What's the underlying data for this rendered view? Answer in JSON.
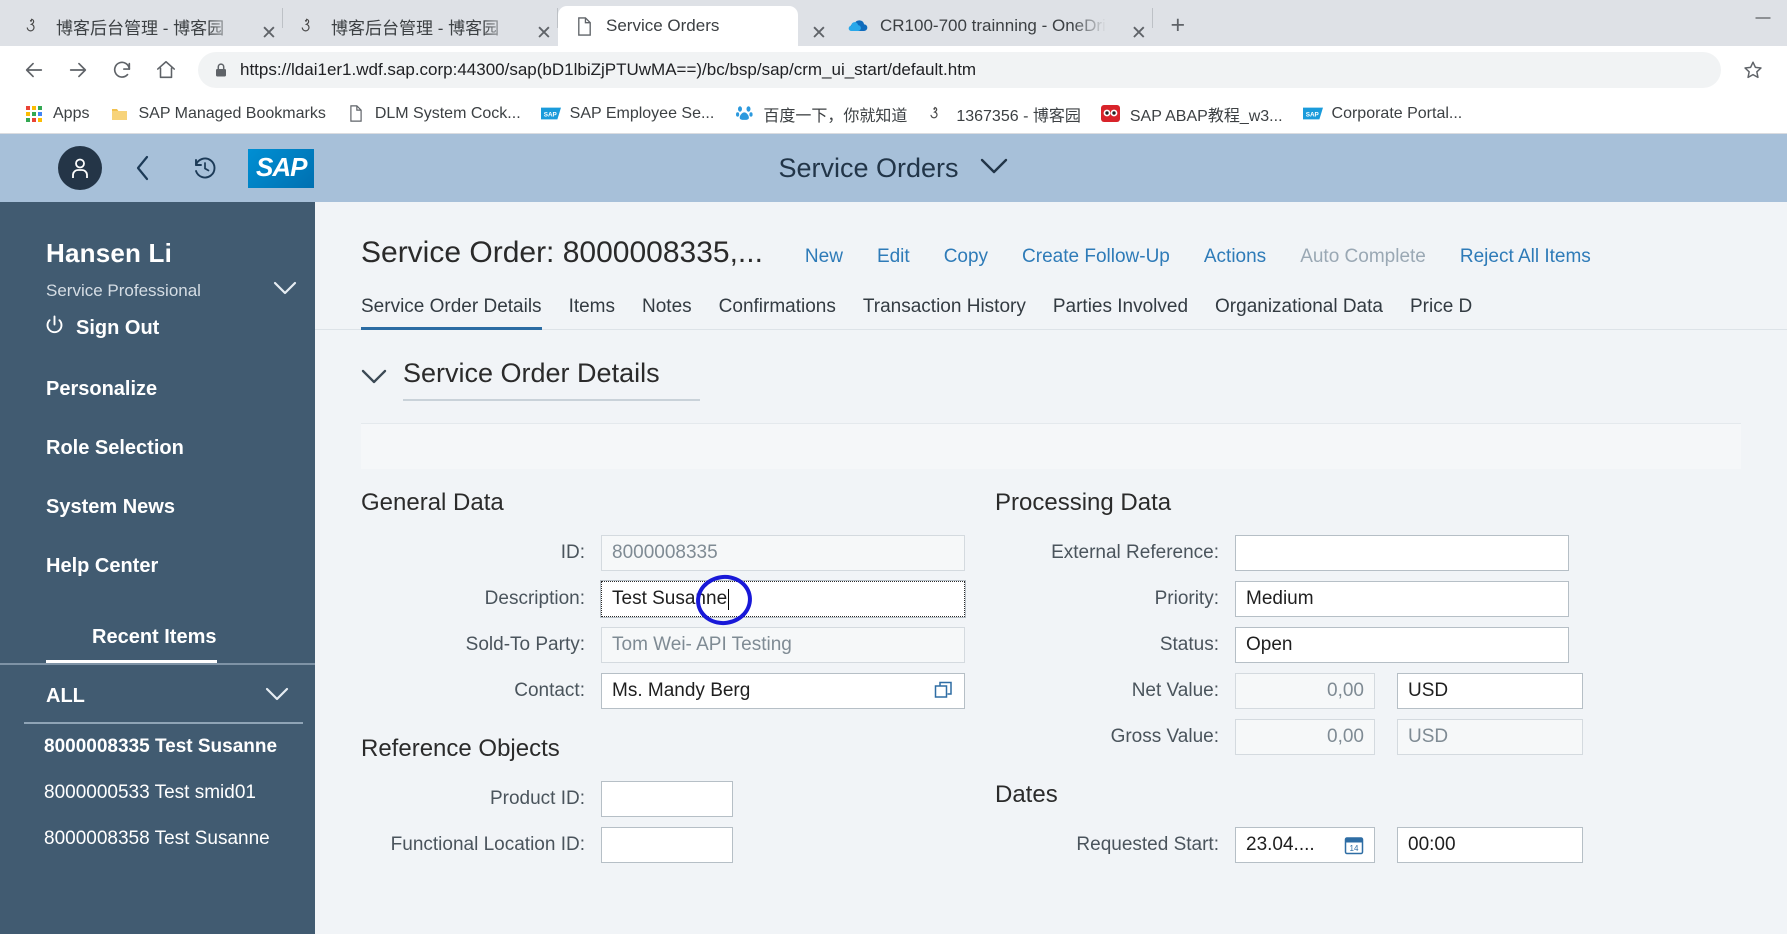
{
  "browser": {
    "tabs": [
      {
        "title": "博客后台管理 - 博客园",
        "favicon": "cnblogs-icon",
        "active": false
      },
      {
        "title": "博客后台管理 - 博客园",
        "favicon": "cnblogs-icon",
        "active": false
      },
      {
        "title": "Service Orders",
        "favicon": "page-icon",
        "active": true
      },
      {
        "title": "CR100-700 trainning - OneDri",
        "favicon": "onedrive-icon",
        "active": false
      }
    ],
    "new_tab_label": "+",
    "close_label": "✕",
    "window": {
      "minimize": "—"
    },
    "toolbar": {
      "back": "←",
      "forward": "→",
      "reload": "⟳",
      "home": "⌂",
      "star": "☆",
      "url_secure": "https://ldai1er1.wdf.sap.corp",
      "url_rest": ":44300/sap(bD1lbiZjPTUwMA==)/bc/bsp/sap/crm_ui_start/default.htm",
      "url_full": "https://ldai1er1.wdf.sap.corp:44300/sap(bD1lbiZjPTUwMA==)/bc/bsp/sap/crm_ui_start/default.htm"
    },
    "bookmarks": [
      {
        "label": "Apps",
        "icon": "apps-grid-icon"
      },
      {
        "label": "SAP Managed Bookmarks",
        "icon": "folder-icon"
      },
      {
        "label": "DLM System Cock...",
        "icon": "page-icon"
      },
      {
        "label": "SAP Employee Se...",
        "icon": "sap-icon"
      },
      {
        "label": "百度一下，你就知道",
        "icon": "baidu-icon"
      },
      {
        "label": "1367356 - 博客园",
        "icon": "cnblogs-icon"
      },
      {
        "label": "SAP ABAP教程_w3...",
        "icon": "owl-icon"
      },
      {
        "label": "Corporate Portal...",
        "icon": "sap-icon"
      }
    ]
  },
  "sap_header": {
    "avatar_icon": "person-icon",
    "back_icon": "chevron-left-icon",
    "history_icon": "history-clock-icon",
    "logo_text": "SAP",
    "title": "Service Orders",
    "title_chevron": "chevron-down-icon"
  },
  "sidebar": {
    "user_name": "Hansen Li",
    "role": "Service Professional",
    "role_chevron": "chevron-down-icon",
    "sign_out": "Sign Out",
    "power_icon": "power-icon",
    "links": [
      {
        "label": "Personalize"
      },
      {
        "label": "Role Selection"
      },
      {
        "label": "System News"
      },
      {
        "label": "Help Center"
      }
    ],
    "recent_items_label": "Recent Items",
    "all_label": "ALL",
    "all_chevron": "chevron-down-icon",
    "recent_items": [
      {
        "label": "8000008335 Test Susanne",
        "selected": true
      },
      {
        "label": "8000000533 Test smid01",
        "selected": false
      },
      {
        "label": "8000008358 Test Susanne",
        "selected": false
      }
    ]
  },
  "main": {
    "page_title": "Service Order: 8000008335,...",
    "actions": [
      {
        "label": "New",
        "disabled": false
      },
      {
        "label": "Edit",
        "disabled": false
      },
      {
        "label": "Copy",
        "disabled": false
      },
      {
        "label": "Create Follow-Up",
        "disabled": false
      },
      {
        "label": "Actions",
        "disabled": false
      },
      {
        "label": "Auto Complete",
        "disabled": true
      },
      {
        "label": "Reject All Items",
        "disabled": false
      }
    ],
    "tabs": [
      {
        "label": "Service Order Details",
        "active": true
      },
      {
        "label": "Items",
        "active": false
      },
      {
        "label": "Notes",
        "active": false
      },
      {
        "label": "Confirmations",
        "active": false
      },
      {
        "label": "Transaction History",
        "active": false
      },
      {
        "label": "Parties Involved",
        "active": false
      },
      {
        "label": "Organizational Data",
        "active": false
      },
      {
        "label": "Price D",
        "active": false
      }
    ],
    "section_title": "Service Order Details",
    "section_chevron": "chevron-down-icon",
    "general_data": {
      "title": "General Data",
      "fields": {
        "id_label": "ID:",
        "id_value": "8000008335",
        "description_label": "Description:",
        "description_value": "Test Susanne",
        "sold_to_label": "Sold-To Party:",
        "sold_to_value": "Tom Wei- API Testing",
        "contact_label": "Contact:",
        "contact_value": "Ms. Mandy Berg",
        "contact_icon": "open-window-icon"
      }
    },
    "reference_objects": {
      "title": "Reference Objects",
      "fields": {
        "product_id_label": "Product ID:",
        "product_id_value": "",
        "functional_location_label": "Functional Location ID:",
        "functional_location_value": ""
      }
    },
    "processing_data": {
      "title": "Processing Data",
      "fields": {
        "external_ref_label": "External Reference:",
        "external_ref_value": "",
        "priority_label": "Priority:",
        "priority_value": "Medium",
        "status_label": "Status:",
        "status_value": "Open",
        "net_value_label": "Net Value:",
        "net_value_amount": "0,00",
        "net_value_currency": "USD",
        "gross_value_label": "Gross Value:",
        "gross_value_amount": "0,00",
        "gross_value_currency": "USD"
      }
    },
    "dates": {
      "title": "Dates",
      "fields": {
        "requested_start_label": "Requested Start:",
        "requested_start_date": "23.04....",
        "requested_start_time": "00:00",
        "calendar_icon": "calendar-icon"
      }
    }
  },
  "annotation": {
    "type": "hand-drawn-circle",
    "color": "#1818d8",
    "target": "description-field"
  }
}
